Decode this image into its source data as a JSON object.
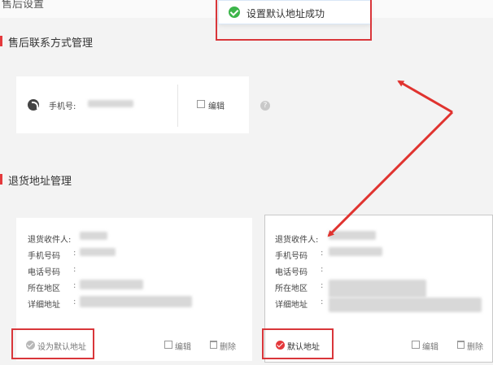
{
  "page": {
    "header_title": "售后设置"
  },
  "toast": {
    "message": "设置默认地址成功"
  },
  "after_sale_contact": {
    "section_title": "售后联系方式管理",
    "phone_label": "手机号:",
    "edit_label": "编辑",
    "help_glyph": "?"
  },
  "return_address": {
    "section_title": "退货地址管理",
    "fields": {
      "receiver": "退货收件人:",
      "mobile": "手机号码",
      "tel": "电话号码",
      "region": "所在地区",
      "detail": "详细地址",
      "colon": ":"
    },
    "cards": [
      {
        "default_action": "设为默认地址",
        "edit": "编辑",
        "delete": "删除"
      },
      {
        "default_action": "默认地址",
        "edit": "编辑",
        "delete": "删除"
      }
    ]
  },
  "colors": {
    "accent_red": "#e4393c",
    "success_green": "#3cb54a"
  }
}
